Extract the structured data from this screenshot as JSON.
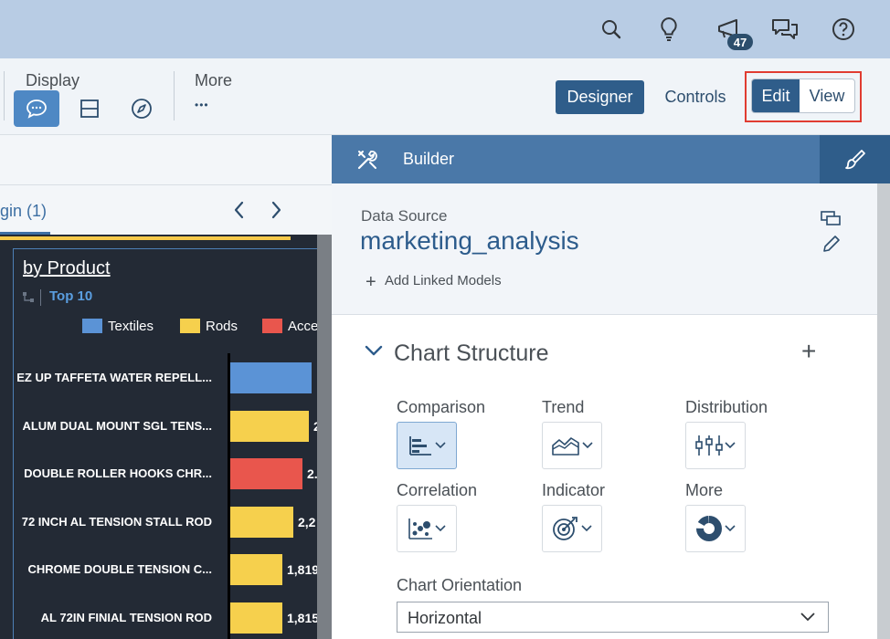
{
  "shell": {
    "notification_count": "47"
  },
  "toolbar": {
    "display_label": "Display",
    "more_label": "More",
    "more_dots": "•••",
    "designer_label": "Designer",
    "controls_label": "Controls",
    "edit_label": "Edit",
    "view_label": "View"
  },
  "left": {
    "tab_label": "gin (1)",
    "chart_title": "by Product",
    "filter_label": "Top 10",
    "legend": [
      {
        "label": "Textiles",
        "color": "#5b93d6"
      },
      {
        "label": "Rods",
        "color": "#f6d04d"
      },
      {
        "label": "Acce",
        "color": "#e9564d"
      }
    ]
  },
  "chart_data": {
    "type": "bar",
    "title": "by Product",
    "orientation": "horizontal",
    "categories": [
      "EZ UP TAFFETA WATER REPELL...",
      "ALUM DUAL MOUNT SGL TENS...",
      "DOUBLE ROLLER HOOKS CHR...",
      "72 INCH AL TENSION STALL ROD",
      "CHROME DOUBLE TENSION C...",
      "AL 72IN FINIAL TENSION ROD"
    ],
    "series_by_category": [
      "Textiles",
      "Rods",
      "Acce",
      "Rods",
      "Rods",
      "Rods"
    ],
    "value_labels": [
      "",
      "2",
      "2.",
      "2,2",
      "1,819",
      "1,815"
    ],
    "bar_colors": [
      "#5b93d6",
      "#f6d04d",
      "#e9564d",
      "#f6d04d",
      "#f6d04d",
      "#f6d04d"
    ],
    "relative_lengths": [
      0.89,
      0.86,
      0.79,
      0.69,
      0.57,
      0.57
    ]
  },
  "builder": {
    "title": "Builder",
    "data_source_label": "Data Source",
    "data_source_name": "marketing_analysis",
    "add_linked_models": "Add Linked Models",
    "chart_structure": "Chart Structure",
    "chart_types": {
      "comparison": "Comparison",
      "trend": "Trend",
      "distribution": "Distribution",
      "correlation": "Correlation",
      "indicator": "Indicator",
      "more": "More"
    },
    "orientation_label": "Chart Orientation",
    "orientation_value": "Horizontal"
  },
  "colors": {
    "shell_bg": "#b8cce4",
    "accent": "#2f5d8a",
    "builder_header": "#4a78a8",
    "chart_bg": "#232a35",
    "highlight_outline": "#e03c31"
  }
}
